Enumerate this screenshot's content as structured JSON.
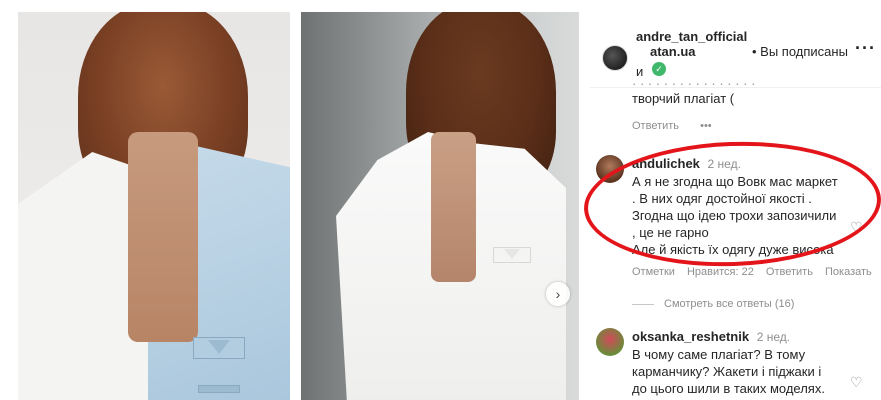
{
  "post": {
    "author": "andre_tan_official",
    "coauthor": "atan.ua",
    "follow_status": "• Вы подписаны",
    "and_text": "и"
  },
  "previous_comment": {
    "line1": "· · · · · · · · · · · · · · · ·",
    "line2": "творчий плагіат (",
    "reply": "Ответить",
    "more": "•••"
  },
  "comments": [
    {
      "user": "andulichek",
      "time": "2 нед.",
      "lines": [
        "А я не згодна що Вовк мас маркет",
        ". В них одяг достойної якості .",
        "Згодна що ідею трохи запозичили",
        ", це не гарно",
        "Але й якість їх одягу дуже висока"
      ],
      "actions": [
        "Отметки",
        "Нравится: 22",
        "Ответить",
        "Показать"
      ]
    },
    {
      "user": "oksanka_reshetnik",
      "time": "2 нед.",
      "lines": [
        "В чому саме плагіат? В тому",
        "карманчику? Жакети і піджаки і",
        "до цього шили в таких моделях."
      ]
    }
  ],
  "view_replies": "Смотреть все ответы (16)",
  "icons": {
    "next": "chevron-right-icon",
    "heart": "heart-icon",
    "more": "more-icon",
    "verified": "verified-icon"
  },
  "colors": {
    "highlight_ellipse": "#e3151a",
    "verified": "#3fb86b"
  }
}
